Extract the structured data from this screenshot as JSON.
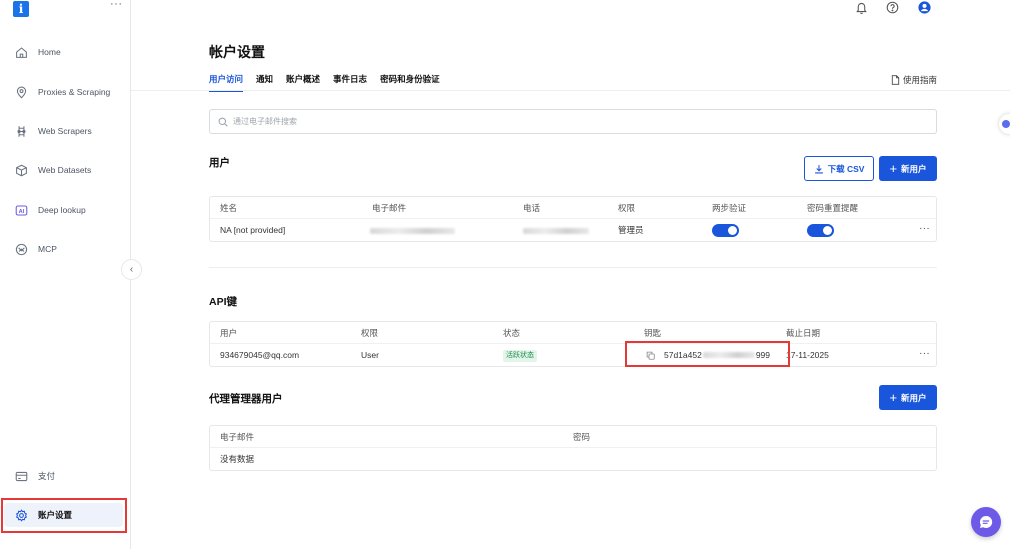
{
  "app": {
    "logo_char": "i",
    "more": "···"
  },
  "sidebar": {
    "items": [
      {
        "label": "Home",
        "icon": "home-icon"
      },
      {
        "label": "Proxies & Scraping",
        "icon": "location-pin-icon"
      },
      {
        "label": "Web Scrapers",
        "icon": "scraper-icon"
      },
      {
        "label": "Web Datasets",
        "icon": "dataset-cube-icon"
      },
      {
        "label": "Deep lookup",
        "icon": "ai-badge-icon",
        "icon_text": "AI"
      },
      {
        "label": "MCP",
        "icon": "mcp-icon"
      }
    ],
    "bottom_items": [
      {
        "label": "支付",
        "icon": "card-icon"
      },
      {
        "label": "账户设置",
        "icon": "gear-icon",
        "active": true
      }
    ],
    "collapse_glyph": "‹"
  },
  "page": {
    "title": "帐户设置",
    "tabs": [
      "用户访问",
      "通知",
      "账户概述",
      "事件日志",
      "密码和身份验证"
    ],
    "active_tab": 0,
    "guide_link": "使用指南"
  },
  "search": {
    "placeholder": "通过电子邮件搜索",
    "value": ""
  },
  "users": {
    "title": "用户",
    "download_csv": "下载 CSV",
    "new_user": "新用户",
    "columns": [
      "姓名",
      "电子邮件",
      "电话",
      "权限",
      "两步验证",
      "密码重置提醒"
    ],
    "rows": [
      {
        "name": "NA [not provided]",
        "email_masked": true,
        "phone_masked": true,
        "role": "管理员",
        "two_factor": true,
        "reset_reminder": true,
        "more": "···"
      }
    ]
  },
  "api_keys": {
    "title": "API键",
    "columns": [
      "用户",
      "权限",
      "状态",
      "钥匙",
      "截止日期"
    ],
    "rows": [
      {
        "user": "934679045@qq.com",
        "role": "User",
        "status": "活跃状态",
        "key_prefix": "57d1a452",
        "key_suffix": "999",
        "expiry": "17-11-2025",
        "more": "···"
      }
    ]
  },
  "proxy_users": {
    "title": "代理管理器用户",
    "new_user": "新用户",
    "columns": [
      "电子邮件",
      "密码"
    ],
    "empty_text": "没有数据"
  },
  "colors": {
    "accent": "#1a56db",
    "highlight": "#e53935",
    "chat": "#6d5ae6",
    "badge_bg": "#e3f5ea",
    "badge_fg": "#1f8a4c"
  }
}
